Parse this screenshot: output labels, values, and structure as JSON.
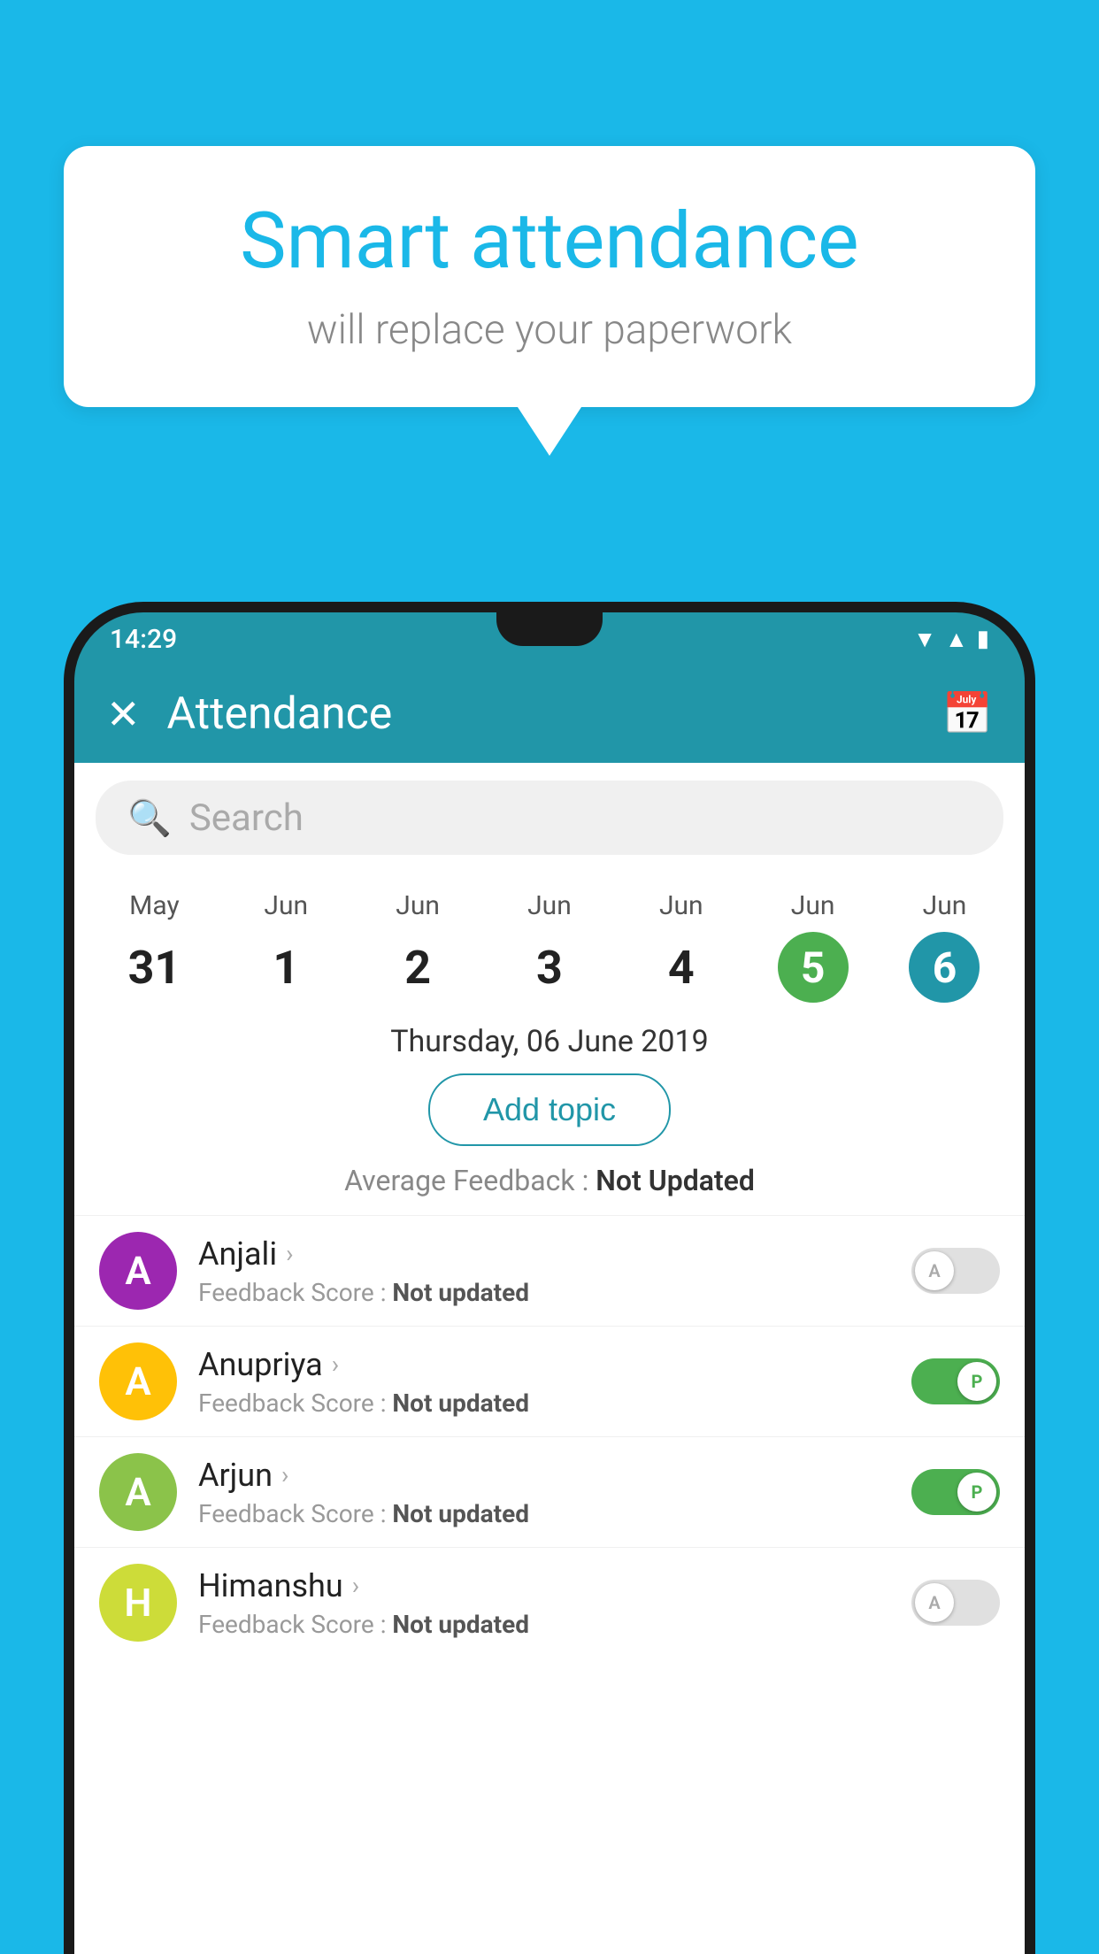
{
  "background_color": "#1ab8e8",
  "bubble": {
    "title": "Smart attendance",
    "subtitle": "will replace your paperwork"
  },
  "app": {
    "status_time": "14:29",
    "title": "Attendance",
    "close_icon": "✕",
    "calendar_icon": "📅"
  },
  "search": {
    "placeholder": "Search"
  },
  "calendar": {
    "days": [
      {
        "month": "May",
        "number": "31",
        "selected": ""
      },
      {
        "month": "Jun",
        "number": "1",
        "selected": ""
      },
      {
        "month": "Jun",
        "number": "2",
        "selected": ""
      },
      {
        "month": "Jun",
        "number": "3",
        "selected": ""
      },
      {
        "month": "Jun",
        "number": "4",
        "selected": ""
      },
      {
        "month": "Jun",
        "number": "5",
        "selected": "green"
      },
      {
        "month": "Jun",
        "number": "6",
        "selected": "blue"
      }
    ]
  },
  "selected_date": "Thursday, 06 June 2019",
  "add_topic_label": "Add topic",
  "average_feedback_label": "Average Feedback :",
  "average_feedback_value": "Not Updated",
  "students": [
    {
      "name": "Anjali",
      "avatar_letter": "A",
      "avatar_color": "#9c27b0",
      "feedback_label": "Feedback Score :",
      "feedback_value": "Not updated",
      "toggle": "off"
    },
    {
      "name": "Anupriya",
      "avatar_letter": "A",
      "avatar_color": "#ffc107",
      "feedback_label": "Feedback Score :",
      "feedback_value": "Not updated",
      "toggle": "on"
    },
    {
      "name": "Arjun",
      "avatar_letter": "A",
      "avatar_color": "#8bc34a",
      "feedback_label": "Feedback Score :",
      "feedback_value": "Not updated",
      "toggle": "on"
    },
    {
      "name": "Himanshu",
      "avatar_letter": "H",
      "avatar_color": "#cddc39",
      "feedback_label": "Feedback Score :",
      "feedback_value": "Not updated",
      "toggle": "off"
    }
  ],
  "toggle_off_label": "A",
  "toggle_on_label": "P"
}
